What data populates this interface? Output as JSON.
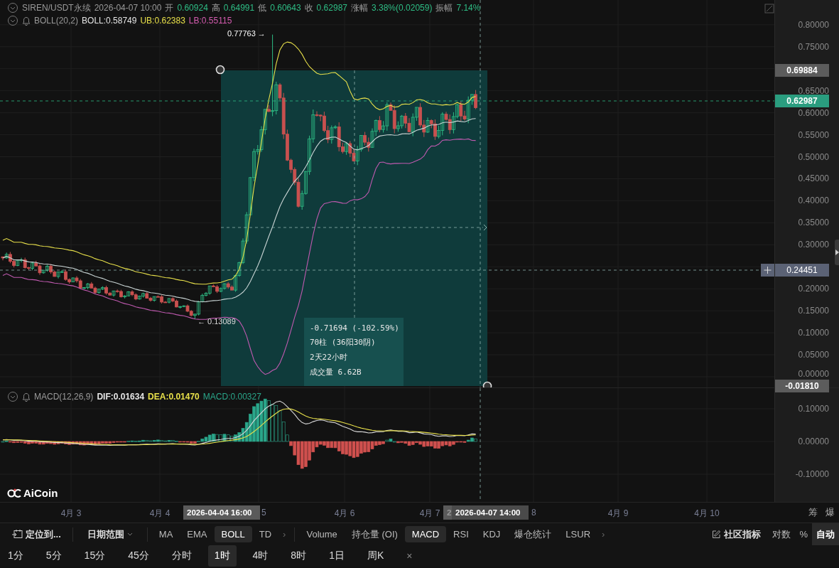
{
  "header": {
    "symbol": "SIREN/USDT永续",
    "time": "2026-04-07 10:00",
    "stats": [
      {
        "label": "开",
        "value": "0.60924"
      },
      {
        "label": "高",
        "value": "0.64991"
      },
      {
        "label": "低",
        "value": "0.60643"
      },
      {
        "label": "收",
        "value": "0.62987"
      },
      {
        "label": "涨幅",
        "value": "3.38%(0.02059)"
      },
      {
        "label": "振幅",
        "value": "7.14%"
      }
    ]
  },
  "boll": {
    "name": "BOLL(20,2)",
    "values": [
      {
        "text": "BOLL:0.58749",
        "color": "#e6e6e6"
      },
      {
        "text": "UB:0.62383",
        "color": "#e8e04a"
      },
      {
        "text": "LB:0.55115",
        "color": "#d65db1"
      }
    ]
  },
  "price_axis": {
    "ticks": [
      "0.80000",
      "0.75000",
      "0.65000",
      "0.60000",
      "0.55000",
      "0.50000",
      "0.45000",
      "0.40000",
      "0.35000",
      "0.30000",
      "0.20000",
      "0.15000",
      "0.10000",
      "0.05000",
      "0.00000"
    ],
    "markers": [
      {
        "kind": "range",
        "text": "0.69884"
      },
      {
        "kind": "last",
        "text": "0.62987"
      },
      {
        "kind": "cursor",
        "text": "0.24451"
      },
      {
        "kind": "range",
        "text": "-0.01810"
      }
    ]
  },
  "annotations": {
    "high": "0.77763 →",
    "low": "← 0.13089"
  },
  "measure": {
    "lines": [
      "-0.71694 (-102.59%)",
      "70柱 (36阳30阴)",
      "2天22小时",
      "成交量 6.62B"
    ]
  },
  "macd": {
    "name": "MACD(12,26,9)",
    "values": [
      {
        "text": "DIF:0.01634",
        "color": "#e6e6e6"
      },
      {
        "text": "DEA:0.01470",
        "color": "#e8e04a"
      },
      {
        "text": "MACD:0.00327",
        "color": "#2aa68a"
      }
    ],
    "ticks": [
      "0.10000",
      "0.00000",
      "-0.10000"
    ]
  },
  "logo": "AiCoin",
  "time_axis": {
    "ticks": [
      "4月 3",
      "4月 4",
      "5",
      "4月 6",
      "4月 7",
      "8",
      "4月 9",
      "4月 10"
    ],
    "labels": [
      {
        "kind": "range",
        "text": "2026-04-04 16:00"
      },
      {
        "kind": "range",
        "text": "2"
      },
      {
        "kind": "cursor",
        "text": "2026-04-07 14:00"
      }
    ],
    "buttons": [
      "筹",
      "爆"
    ]
  },
  "indicator_bar": {
    "locate": "定位到...",
    "date_range": "日期范围",
    "main_indicators": [
      {
        "label": "MA",
        "selected": false
      },
      {
        "label": "EMA",
        "selected": false
      },
      {
        "label": "BOLL",
        "selected": true
      },
      {
        "label": "TD",
        "selected": false
      }
    ],
    "main_more": "›",
    "sub_indicators": [
      {
        "label": "Volume",
        "selected": false
      },
      {
        "label": "持仓量 (OI)",
        "selected": false
      },
      {
        "label": "MACD",
        "selected": true
      },
      {
        "label": "RSI",
        "selected": false
      },
      {
        "label": "KDJ",
        "selected": false
      },
      {
        "label": "爆仓统计",
        "selected": false
      },
      {
        "label": "LSUR",
        "selected": false
      }
    ],
    "sub_more": "›",
    "community": "社区指标",
    "scale_options": [
      {
        "label": "对数",
        "selected": false
      },
      {
        "label": "%",
        "selected": false
      },
      {
        "label": "自动",
        "selected": true
      }
    ]
  },
  "intervals": [
    {
      "label": "1分",
      "selected": false
    },
    {
      "label": "5分",
      "selected": false
    },
    {
      "label": "15分",
      "selected": false
    },
    {
      "label": "45分",
      "selected": false
    },
    {
      "label": "分时",
      "selected": false
    },
    {
      "label": "1时",
      "selected": true
    },
    {
      "label": "4时",
      "selected": false
    },
    {
      "label": "8时",
      "selected": false
    },
    {
      "label": "1日",
      "selected": false
    },
    {
      "label": "周K",
      "selected": false
    }
  ],
  "intervals_close": "×"
}
